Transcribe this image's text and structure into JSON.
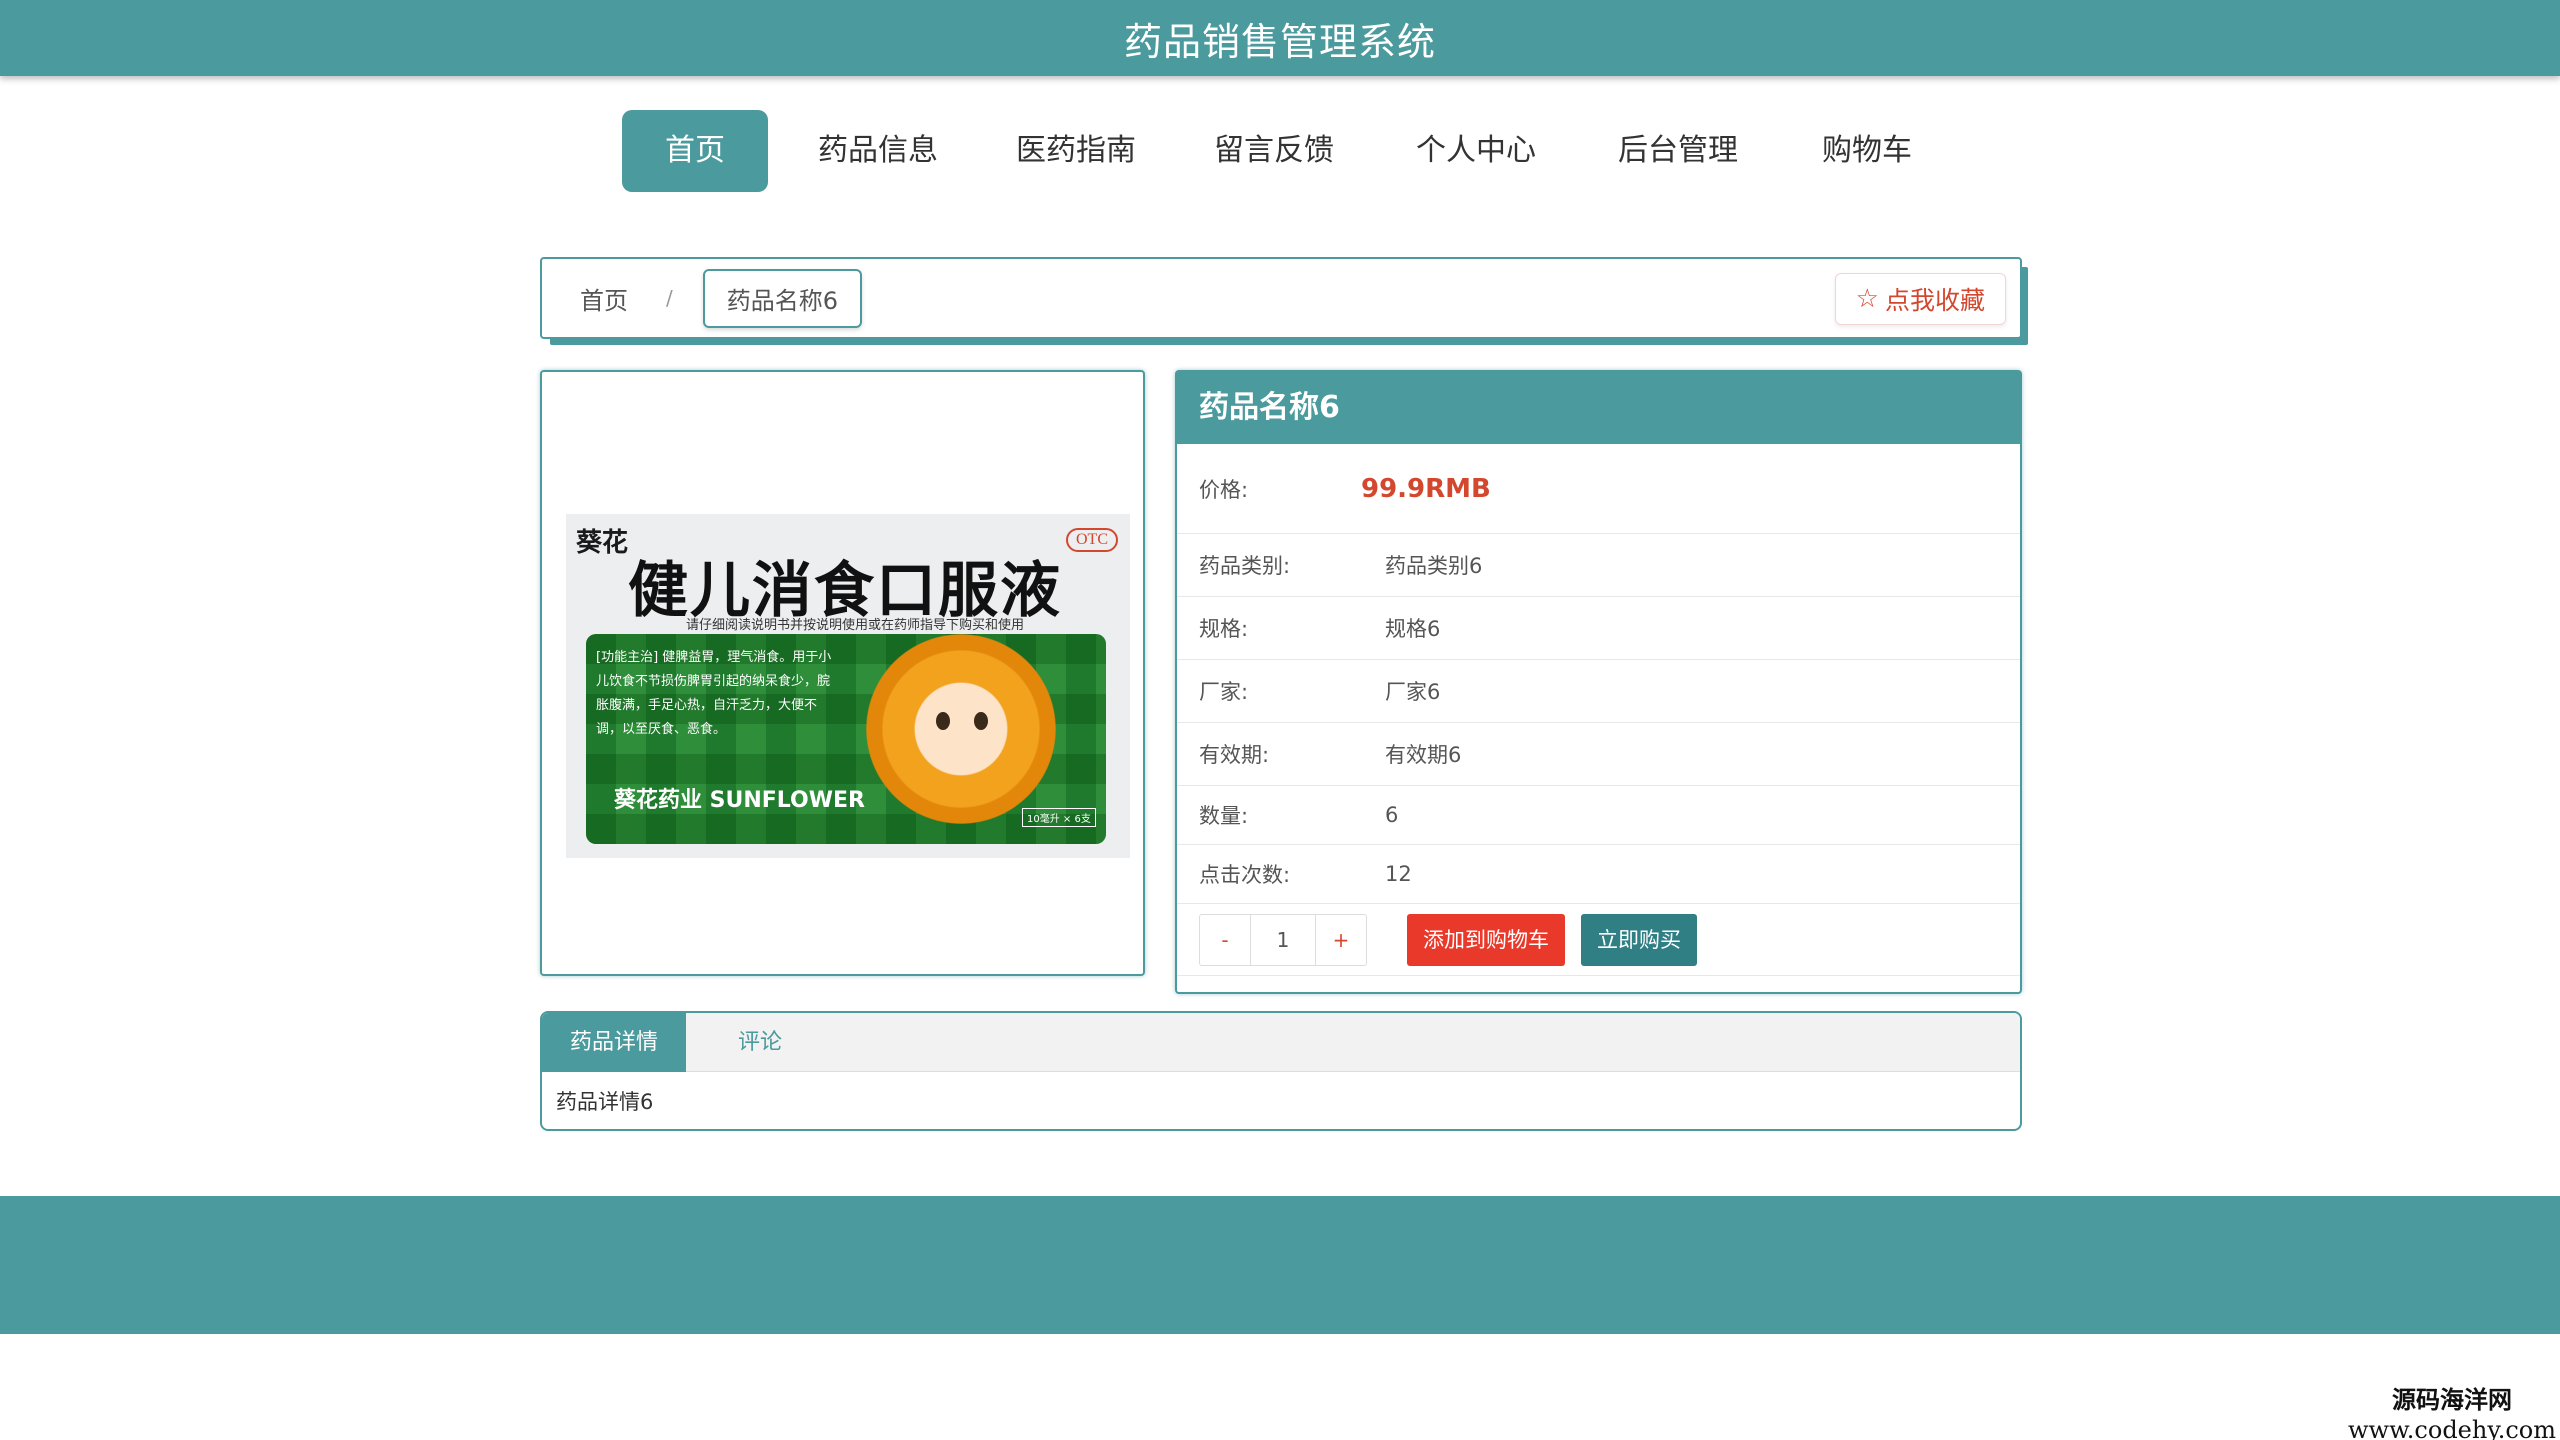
{
  "header": {
    "title": "药品销售管理系统"
  },
  "nav": {
    "items": [
      {
        "label": "首页",
        "active": true
      },
      {
        "label": "药品信息"
      },
      {
        "label": "医药指南"
      },
      {
        "label": "留言反馈"
      },
      {
        "label": "个人中心"
      },
      {
        "label": "后台管理"
      },
      {
        "label": "购物车"
      }
    ]
  },
  "breadcrumb": {
    "home": "首页",
    "separator": "/",
    "current": "药品名称6",
    "favorite_label": "点我收藏",
    "favorite_icon": "star-outline-icon"
  },
  "product_image": {
    "brand": "葵花",
    "otc": "OTC",
    "name": "健儿消食口服液",
    "subtitle": "请仔细阅读说明书并按说明使用或在药师指导下购买和使用",
    "function_text": "[功能主治] 健脾益胃，理气消食。用于小儿饮食不节损伤脾胃引起的纳呆食少，脘胀腹满，手足心热，自汗乏力，大便不调，以至厌食、恶食。",
    "logo": "葵花药业 SUNFLOWER",
    "spec": "10毫升 × 6支"
  },
  "info": {
    "title": "药品名称6",
    "price_label": "价格:",
    "price_value": "99.9RMB",
    "category_label": "药品类别:",
    "category_value": "药品类别6",
    "spec_label": "规格:",
    "spec_value": "规格6",
    "maker_label": "厂家:",
    "maker_value": "厂家6",
    "expiry_label": "有效期:",
    "expiry_value": "有效期6",
    "quantity_label": "数量:",
    "quantity_value": "6",
    "clicks_label": "点击次数:",
    "clicks_value": "12"
  },
  "actions": {
    "minus": "-",
    "qty": "1",
    "plus": "+",
    "add_cart": "添加到购物车",
    "buy_now": "立即购买"
  },
  "tabs": {
    "items": [
      {
        "label": "药品详情",
        "active": true
      },
      {
        "label": "评论"
      }
    ],
    "content": "药品详情6"
  },
  "watermark": {
    "line1": "源码海洋网",
    "line2": "www.codehy.com"
  },
  "colors": {
    "primary": "#4b9a9d",
    "danger": "#e8392a",
    "price": "#d4472f",
    "buy": "#2f7f84"
  }
}
